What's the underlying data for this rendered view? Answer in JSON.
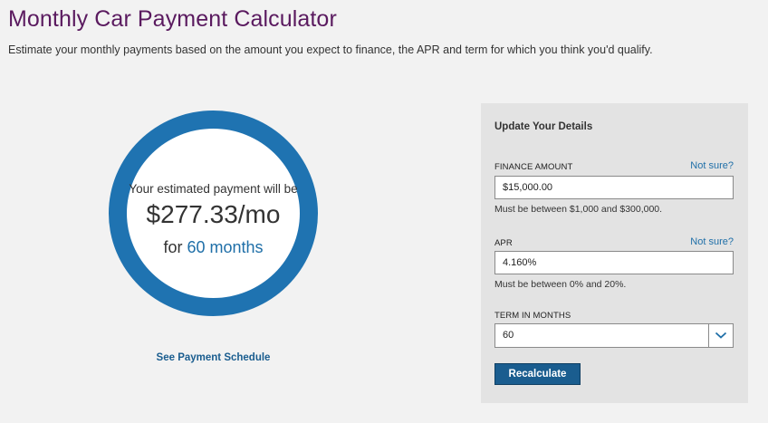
{
  "header": {
    "title": "Monthly Car Payment Calculator",
    "subtitle": "Estimate your monthly payments based on the amount you expect to finance, the APR and term for which you think you'd qualify."
  },
  "result": {
    "label": "Your estimated payment will be",
    "amount": "$277.33/mo",
    "term_prefix": "for",
    "term_months": "60 months",
    "schedule_link": "See Payment Schedule"
  },
  "panel": {
    "title": "Update Your Details",
    "finance": {
      "label": "FINANCE AMOUNT",
      "help": "Not sure?",
      "value": "$15,000.00",
      "hint": "Must be between $1,000 and $300,000."
    },
    "apr": {
      "label": "APR",
      "help": "Not sure?",
      "value": "4.160%",
      "hint": "Must be between 0% and 20%."
    },
    "term": {
      "label": "TERM IN MONTHS",
      "value": "60"
    },
    "button": "Recalculate"
  },
  "colors": {
    "title": "#5a1a5f",
    "ring": "#1f73b1",
    "link": "#1f6fa8",
    "button": "#1a5d8f"
  }
}
